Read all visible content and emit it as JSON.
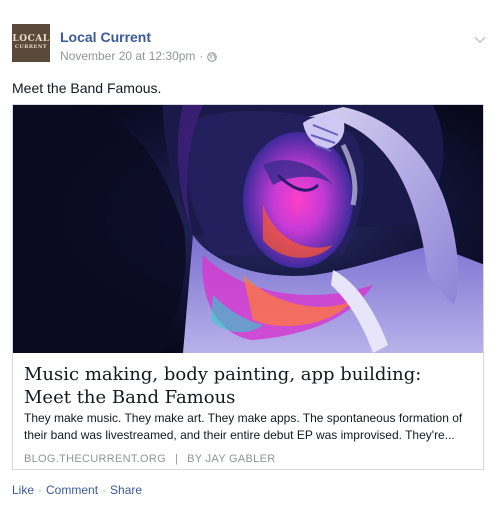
{
  "post": {
    "page_name": "Local Current",
    "avatar": {
      "line1": "LOCAL",
      "line2": "CURRENT"
    },
    "timestamp": "November 20 at 12:30pm",
    "meta_separator": "·",
    "privacy_icon": "globe-icon",
    "options_icon": "chevron-down-icon",
    "message": "Meet the Band Famous."
  },
  "link_card": {
    "title": "Music making, body painting, app building: Meet the Band Famous",
    "summary": "They make music. They make art. They make apps. The spontaneous formation of their band was livestreamed, and their entire debut EP was improvised. They're...",
    "domain": "BLOG.THECURRENT.ORG",
    "divider": "|",
    "byline": "BY JAY GABLER"
  },
  "actions": {
    "like": "Like",
    "comment": "Comment",
    "share": "Share",
    "separator": "·"
  },
  "colors": {
    "link_blue": "#3b5998",
    "meta_gray": "#90949c",
    "border": "#d6d9de"
  }
}
